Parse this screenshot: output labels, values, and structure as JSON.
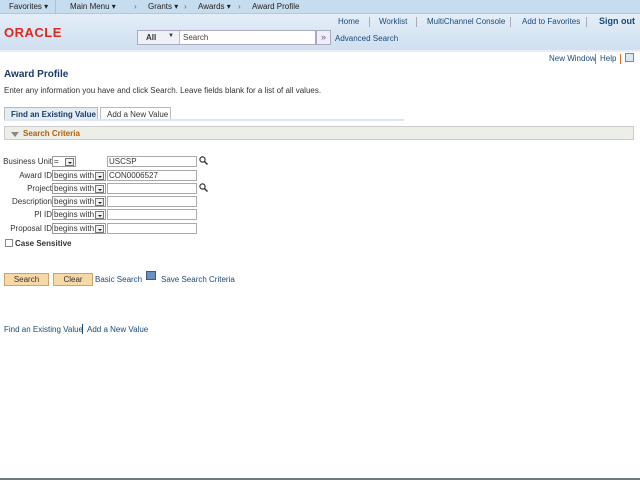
{
  "nav": {
    "favorites": "Favorites ▾",
    "main_menu": "Main Menu ▾",
    "crumbs": [
      "Grants ▾",
      "Awards ▾",
      "Award Profile"
    ],
    "sep": "›"
  },
  "header": {
    "logo": "ORACLE",
    "links": [
      "Home",
      "Worklist",
      "MultiChannel Console",
      "Add to Favorites",
      "Sign out"
    ],
    "search_scope": "All",
    "search_placeholder": "Search",
    "go": "»",
    "advanced_search": "Advanced Search"
  },
  "page": {
    "new_window": "New Window",
    "help": "Help",
    "title": "Award Profile",
    "instructions": "Enter any information you have and click Search. Leave fields blank for a list of all values.",
    "tabs": [
      "Find an Existing Value",
      "Add a New Value"
    ],
    "section": "Search Criteria",
    "fields": [
      {
        "label": "Business Unit",
        "op": "=",
        "value": "USCSP",
        "lookup": true
      },
      {
        "label": "Award ID",
        "op": "begins with",
        "value": "CON0006527",
        "lookup": false
      },
      {
        "label": "Project",
        "op": "begins with",
        "value": "",
        "lookup": true
      },
      {
        "label": "Description",
        "op": "begins with",
        "value": "",
        "lookup": false
      },
      {
        "label": "PI ID",
        "op": "begins with",
        "value": "",
        "lookup": false
      },
      {
        "label": "Proposal ID",
        "op": "begins with",
        "value": "",
        "lookup": false
      }
    ],
    "case_sensitive": "Case Sensitive",
    "case_sensitive_checked": false,
    "search_btn": "Search",
    "clear_btn": "Clear",
    "basic_search": "Basic Search",
    "save_criteria": "Save Search Criteria",
    "footer_links": [
      "Find an Existing Value",
      "Add a New Value"
    ]
  }
}
